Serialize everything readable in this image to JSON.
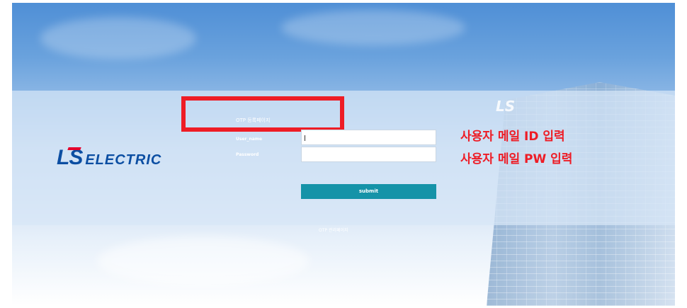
{
  "brand": {
    "ls": "LS",
    "electric": "ELECTRIC"
  },
  "building_logo": "LS",
  "form": {
    "title": "OTP 등록페이지",
    "username_label": "User_name",
    "password_label": "Password",
    "username_value": "",
    "password_value": "",
    "submit_label": "submit",
    "manage_link": "OTP 관리페이지"
  },
  "annotations": {
    "id_note": "사용자 메일 ID 입력",
    "pw_note": "사용자 메일 PW 입력",
    "highlight_color": "#ee1c25"
  },
  "colors": {
    "brand_blue": "#0b4ea2",
    "submit_bg": "#1593a8"
  }
}
